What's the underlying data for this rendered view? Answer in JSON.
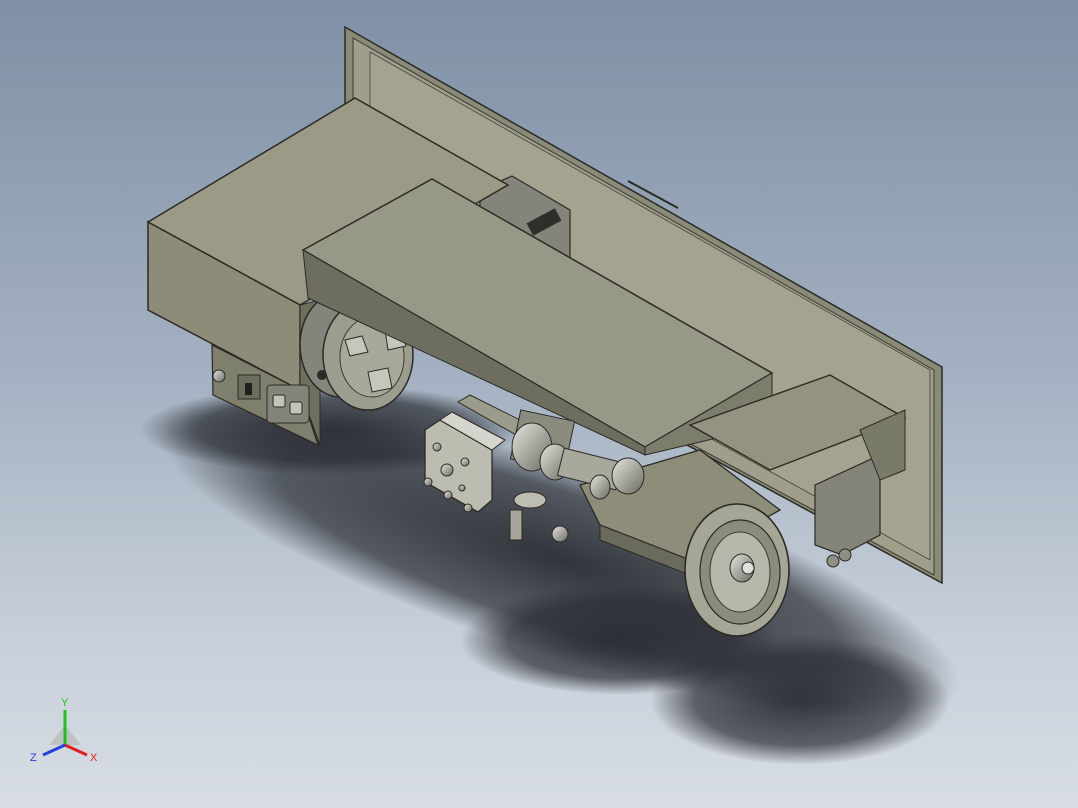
{
  "viewport": {
    "background_top": "#7f90a6",
    "background_bottom": "#d8dde4"
  },
  "model": {
    "body_color": "#8f8f7c",
    "body_dark": "#5e5e50",
    "metal_color": "#b9b9b2",
    "parts": [
      "base-plate",
      "headstock",
      "chuck",
      "top-cover",
      "control-panel",
      "tool-post",
      "cross-slide",
      "tailstock-bed",
      "handwheel",
      "leadscrew-motor"
    ]
  },
  "control_panel": {
    "buttons": [
      "",
      ""
    ]
  },
  "triad": {
    "y_label": "Y",
    "x_label": "X",
    "z_label": "Z",
    "x_color": "#e02020",
    "y_color": "#20c020",
    "z_color": "#2040e0"
  }
}
